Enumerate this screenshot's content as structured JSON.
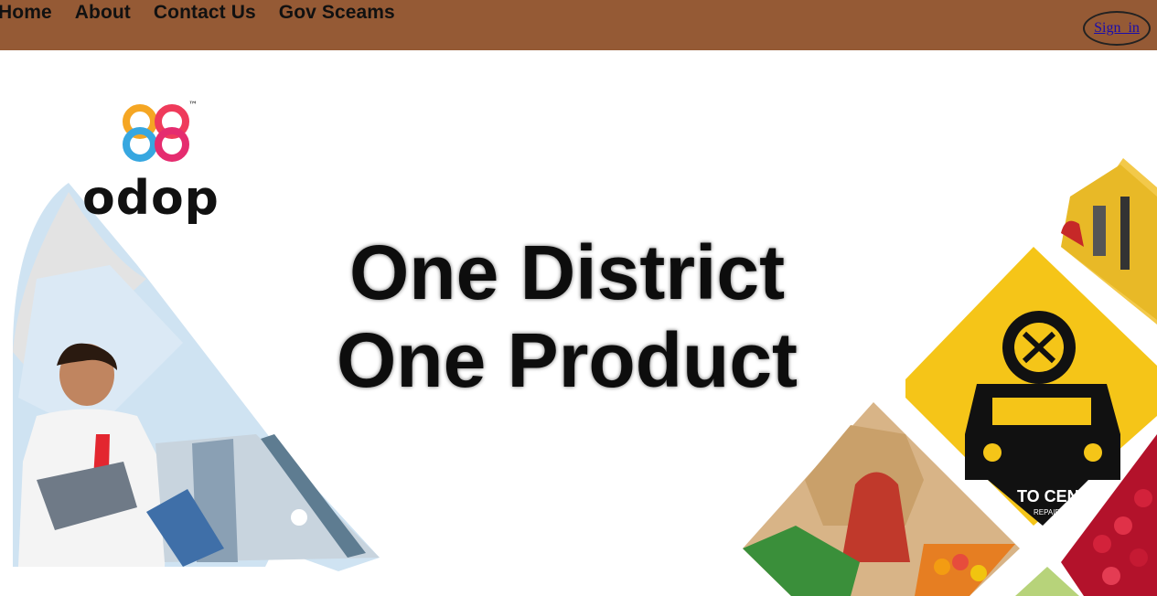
{
  "nav": {
    "items": [
      {
        "label": "Home"
      },
      {
        "label": "About"
      },
      {
        "label": "Contact Us"
      },
      {
        "label": "Gov Sceams"
      }
    ],
    "sign_in": "Sign_in"
  },
  "hero": {
    "logo_text": "odop",
    "logo_tm": "™",
    "title_line1": "One District",
    "title_line2": "One Product",
    "sign_text": "TO CEN",
    "sign_subtext": "REPAIR"
  },
  "colors": {
    "topbar": "#955a35",
    "accent_yellow": "#f5c518"
  }
}
